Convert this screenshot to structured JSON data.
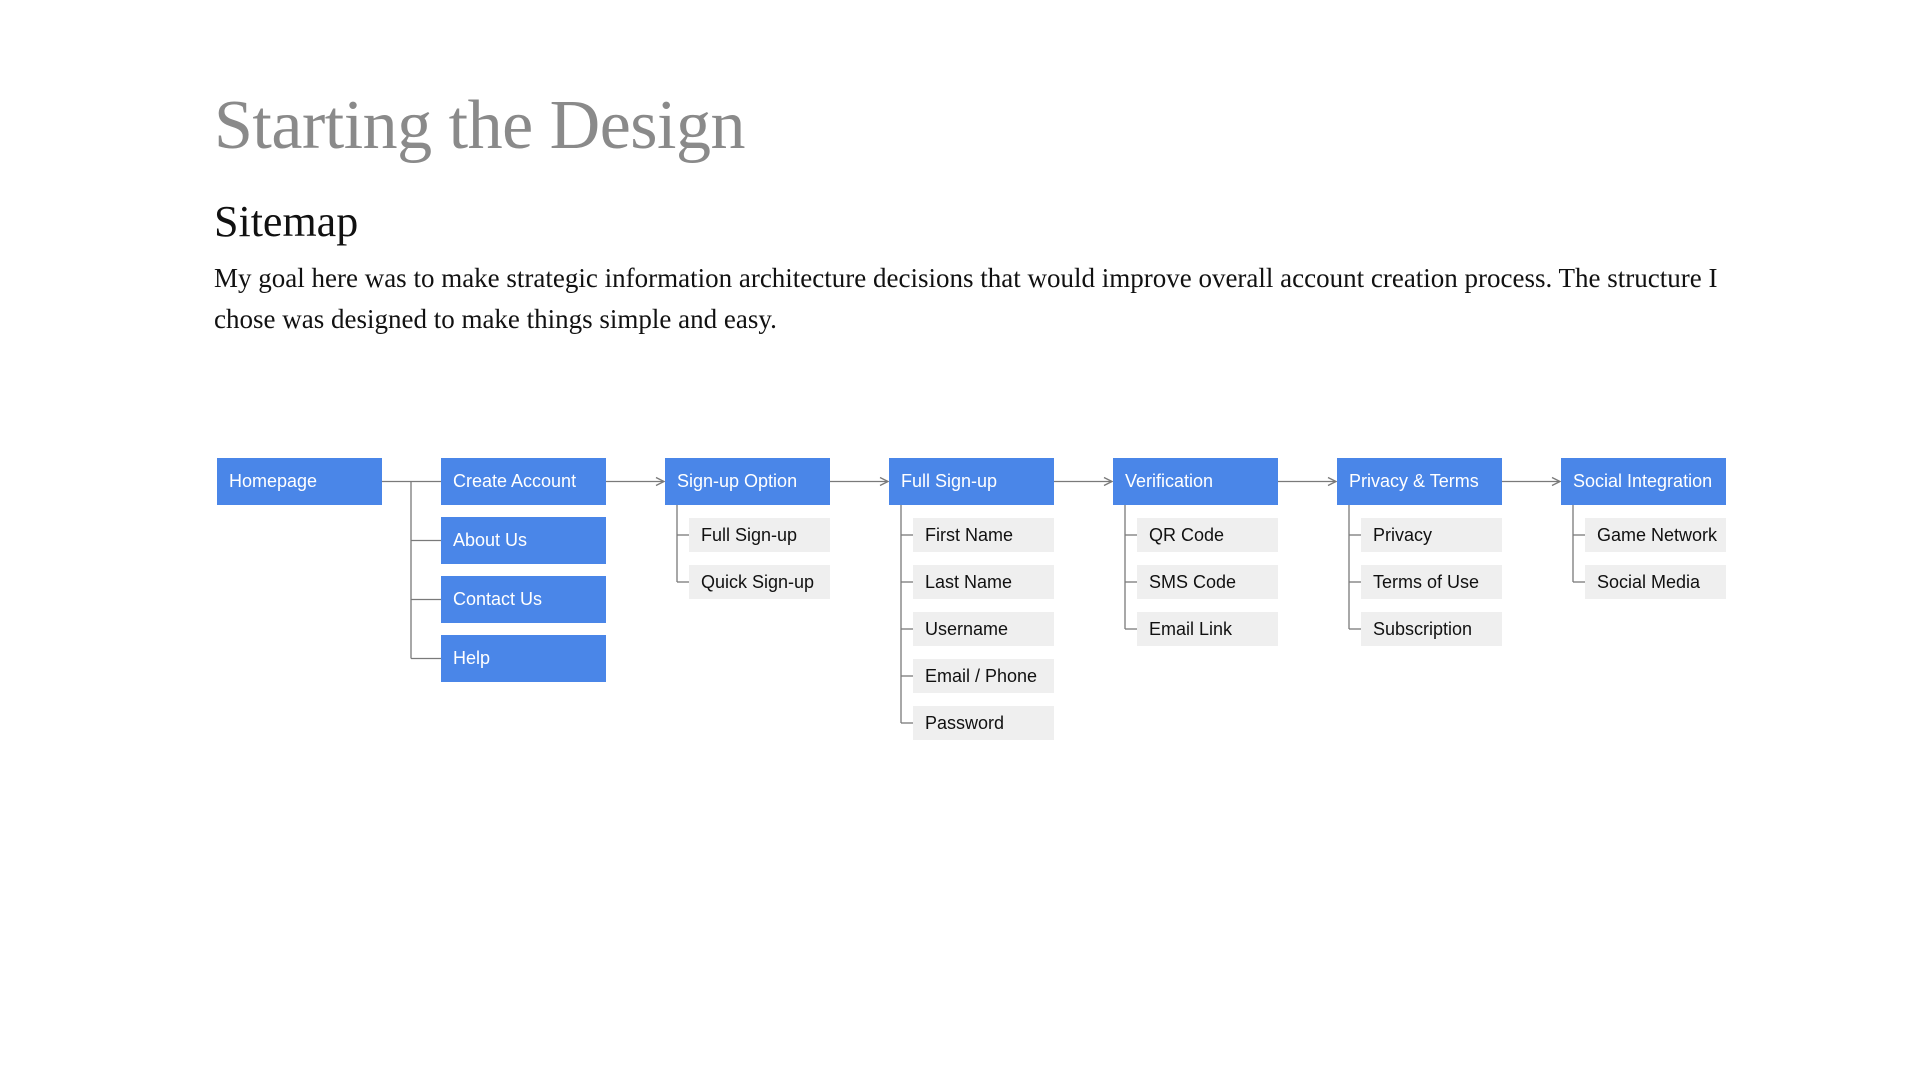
{
  "header": {
    "title": "Starting the Design",
    "subtitle": "Sitemap",
    "description": "My goal here was to make strategic information architecture decisions that would improve overall account creation process. The structure I chose was designed to make things simple and easy."
  },
  "colors": {
    "primary_node": "#4a86e8",
    "secondary_node": "#efefef",
    "connector": "#7a7a7a"
  },
  "sitemap": {
    "homepage": "Homepage",
    "site_pages": [
      "Create Account",
      "About Us",
      "Contact Us",
      "Help"
    ],
    "flow": [
      {
        "label": "Sign-up Option",
        "children": [
          "Full Sign-up",
          "Quick Sign-up"
        ]
      },
      {
        "label": "Full Sign-up",
        "children": [
          "First Name",
          "Last Name",
          "Username",
          "Email / Phone",
          "Password"
        ]
      },
      {
        "label": "Verification",
        "children": [
          "QR Code",
          "SMS Code",
          "Email Link"
        ]
      },
      {
        "label": "Privacy & Terms",
        "children": [
          "Privacy",
          "Terms of Use",
          "Subscription"
        ]
      },
      {
        "label": "Social Integration",
        "children": [
          "Game Network",
          "Social Media"
        ]
      }
    ]
  }
}
